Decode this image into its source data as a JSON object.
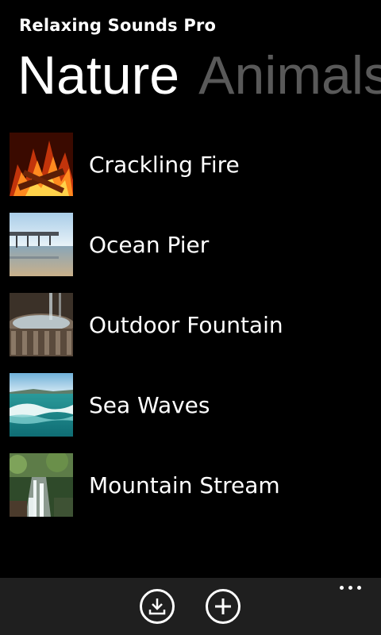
{
  "app": {
    "title": "Relaxing Sounds Pro"
  },
  "pivot": {
    "active": "Nature",
    "next": "Animals"
  },
  "sounds": [
    {
      "name": "Crackling Fire",
      "thumb": "fire-thumbnail"
    },
    {
      "name": "Ocean Pier",
      "thumb": "pier-thumbnail"
    },
    {
      "name": "Outdoor Fountain",
      "thumb": "fountain-thumbnail"
    },
    {
      "name": "Sea Waves",
      "thumb": "waves-thumbnail"
    },
    {
      "name": "Mountain Stream",
      "thumb": "stream-thumbnail"
    }
  ],
  "appbar": {
    "buttons": [
      {
        "icon": "download-icon"
      },
      {
        "icon": "add-icon"
      }
    ],
    "more_icon": "more-dots-icon"
  },
  "colors": {
    "background": "#000000",
    "foreground": "#ffffff",
    "inactive_pivot": "#595959",
    "appbar": "#1f1f1f"
  }
}
